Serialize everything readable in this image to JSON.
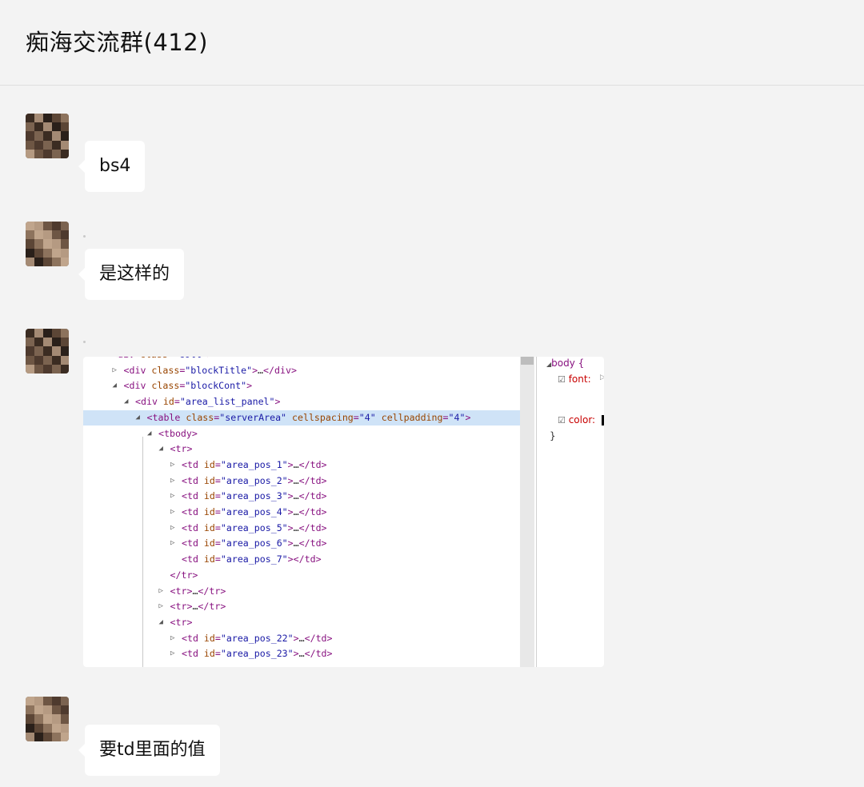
{
  "header": {
    "title": "痴海交流群(412)"
  },
  "messages": [
    {
      "text": "bs4"
    },
    {
      "text": "是这样的"
    },
    {
      "text": "要td里面的值"
    }
  ],
  "devtools": {
    "dom_lines": [
      {
        "arrow": "down",
        "indent": 0,
        "html": "<div class=\"coll\">"
      },
      {
        "arrow": "right",
        "indent": 1,
        "html": "<div class=\"blockTitle\">…</div>"
      },
      {
        "arrow": "down",
        "indent": 1,
        "html": "<div class=\"blockCont\">"
      },
      {
        "arrow": "down",
        "indent": 2,
        "html": "<div id=\"area_list_panel\">"
      },
      {
        "arrow": "down",
        "indent": 3,
        "html": "<table class=\"serverArea\" cellspacing=\"4\" cellpadding=\"4\">",
        "selected": true
      },
      {
        "arrow": "down",
        "indent": 4,
        "html": "<tbody>"
      },
      {
        "arrow": "down",
        "indent": 5,
        "html": "<tr>"
      },
      {
        "arrow": "right",
        "indent": 6,
        "html": "<td id=\"area_pos_1\">…</td>"
      },
      {
        "arrow": "right",
        "indent": 6,
        "html": "<td id=\"area_pos_2\">…</td>"
      },
      {
        "arrow": "right",
        "indent": 6,
        "html": "<td id=\"area_pos_3\">…</td>"
      },
      {
        "arrow": "right",
        "indent": 6,
        "html": "<td id=\"area_pos_4\">…</td>"
      },
      {
        "arrow": "right",
        "indent": 6,
        "html": "<td id=\"area_pos_5\">…</td>"
      },
      {
        "arrow": "right",
        "indent": 6,
        "html": "<td id=\"area_pos_6\">…</td>"
      },
      {
        "arrow": "none",
        "indent": 6,
        "html": "<td id=\"area_pos_7\"></td>"
      },
      {
        "arrow": "none",
        "indent": 5,
        "html": "</tr>"
      },
      {
        "arrow": "right",
        "indent": 5,
        "html": "<tr>…</tr>"
      },
      {
        "arrow": "right",
        "indent": 5,
        "html": "<tr>…</tr>"
      },
      {
        "arrow": "down",
        "indent": 5,
        "html": "<tr>"
      },
      {
        "arrow": "right",
        "indent": 6,
        "html": "<td id=\"area_pos_22\">…</td>"
      },
      {
        "arrow": "right",
        "indent": 6,
        "html": "<td id=\"area_pos_23\">…</td>"
      }
    ],
    "styles": {
      "selector": "body {",
      "props": [
        "font:",
        "color:"
      ],
      "close": "}"
    }
  }
}
